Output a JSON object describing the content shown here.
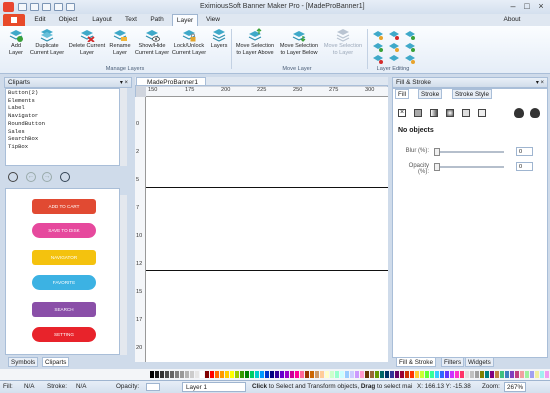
{
  "window": {
    "title": "EximiousSoft Banner Maker Pro - [MadeProBanner1]",
    "about": "About"
  },
  "menu_tabs": [
    "Edit",
    "Object",
    "Layout",
    "Text",
    "Path",
    "Layer",
    "View"
  ],
  "active_tab": "Layer",
  "ribbon": {
    "buttons": [
      {
        "label1": "Add",
        "label2": "Layer"
      },
      {
        "label1": "Duplicate",
        "label2": "Current Layer"
      },
      {
        "label1": "Delete Current",
        "label2": "Layer"
      },
      {
        "label1": "Rename",
        "label2": "Layer"
      },
      {
        "label1": "Show/Hide",
        "label2": "Current Layer"
      },
      {
        "label1": "Lock/Unlock",
        "label2": "Current Layer"
      },
      {
        "label1": "Layers",
        "label2": ""
      },
      {
        "label1": "Move Selection",
        "label2": "to Layer Above"
      },
      {
        "label1": "Move Selection",
        "label2": "to Layer Below"
      },
      {
        "label1": "Move Selection",
        "label2": "to Layer"
      }
    ],
    "groups": [
      "Manage Layers",
      "Move Layer",
      "Layer Editing"
    ]
  },
  "cliparts": {
    "title": "Cliparts",
    "items": [
      "Button(2)",
      "Elements",
      "Label",
      "Navigator",
      "RoundButton",
      "Sales",
      "SearchBox",
      "TipBox"
    ],
    "previews": [
      {
        "label": "ADD TO CART",
        "color": "#e14a32"
      },
      {
        "label": "SAVE TO DISK",
        "color": "#e6499d"
      },
      {
        "label": "NAVIGATOR",
        "color": "#f4c20e"
      },
      {
        "label": "FAVORITE",
        "color": "#3cb2e3"
      },
      {
        "label": "SEARCH",
        "color": "#8a4fa8"
      },
      {
        "label": "SETTING",
        "color": "#e8232b"
      }
    ],
    "bottom_tabs": [
      "Symbols",
      "Cliparts"
    ]
  },
  "document": {
    "tab": "MadeProBanner1",
    "ruler_top": [
      "150",
      "175",
      "200",
      "225",
      "250",
      "275",
      "300"
    ],
    "ruler_left": [
      "0",
      "2",
      "5",
      "7",
      "10",
      "12",
      "15",
      "17",
      "20",
      "22"
    ]
  },
  "fill_stroke": {
    "title": "Fill & Stroke",
    "tabs": [
      "Fill",
      "Stroke",
      "Stroke Style"
    ],
    "no_objects": "No objects",
    "blur_label": "Blur (%):",
    "blur_value": "0",
    "opacity_label": "Opacity (%):",
    "opacity_value": "0",
    "bottom_tabs": [
      "Fill & Stroke",
      "Filters",
      "Widgets"
    ]
  },
  "status": {
    "fill_label": "Fill:",
    "fill_value": "N/A",
    "stroke_label": "Stroke:",
    "stroke_value": "N/A",
    "opacity_label": "Opacity:",
    "layer": "Layer 1",
    "hint_click": "Click",
    "hint_text1": " to Select and Transform objects, ",
    "hint_drag": "Drag",
    "hint_text2": " to select mai",
    "coords": "X: 166.13 Y: -15.38",
    "zoom_label": "Zoom:",
    "zoom": "267%"
  },
  "palette": [
    "#000000",
    "#1a1a1a",
    "#333333",
    "#4d4d4d",
    "#666666",
    "#808080",
    "#999999",
    "#b3b3b3",
    "#cccccc",
    "#e6e6e6",
    "#ffffff",
    "#800000",
    "#ff0000",
    "#ff6600",
    "#ff9900",
    "#ffcc00",
    "#ffff00",
    "#99cc00",
    "#339900",
    "#008000",
    "#00cc66",
    "#00cccc",
    "#0099ff",
    "#0033cc",
    "#000080",
    "#330099",
    "#6600cc",
    "#9900cc",
    "#cc0099",
    "#ff0099",
    "#ff6699",
    "#993300",
    "#cc6600",
    "#cc9966",
    "#ffcc99",
    "#ffffcc",
    "#ccffcc",
    "#99ffcc",
    "#ccffff",
    "#99ccff",
    "#ccccff",
    "#cc99ff",
    "#ff99cc",
    "#663300",
    "#996633",
    "#669900",
    "#006666",
    "#003366",
    "#333399",
    "#660066",
    "#990033",
    "#cc3300",
    "#ff3300",
    "#ffcc33",
    "#ccff33",
    "#66ff33",
    "#33ff99",
    "#33ccff",
    "#3366ff",
    "#6633ff",
    "#cc33ff",
    "#ff33cc",
    "#ff3366",
    "#e0e0e0",
    "#c0c0c0",
    "#a0a0a0",
    "#808000",
    "#008080",
    "#800080",
    "#c08040",
    "#40c080",
    "#4080c0",
    "#8040c0",
    "#c04080",
    "#f0a0a0",
    "#a0f0a0",
    "#a0a0f0",
    "#f0f0a0",
    "#a0f0f0",
    "#f0a0f0"
  ]
}
